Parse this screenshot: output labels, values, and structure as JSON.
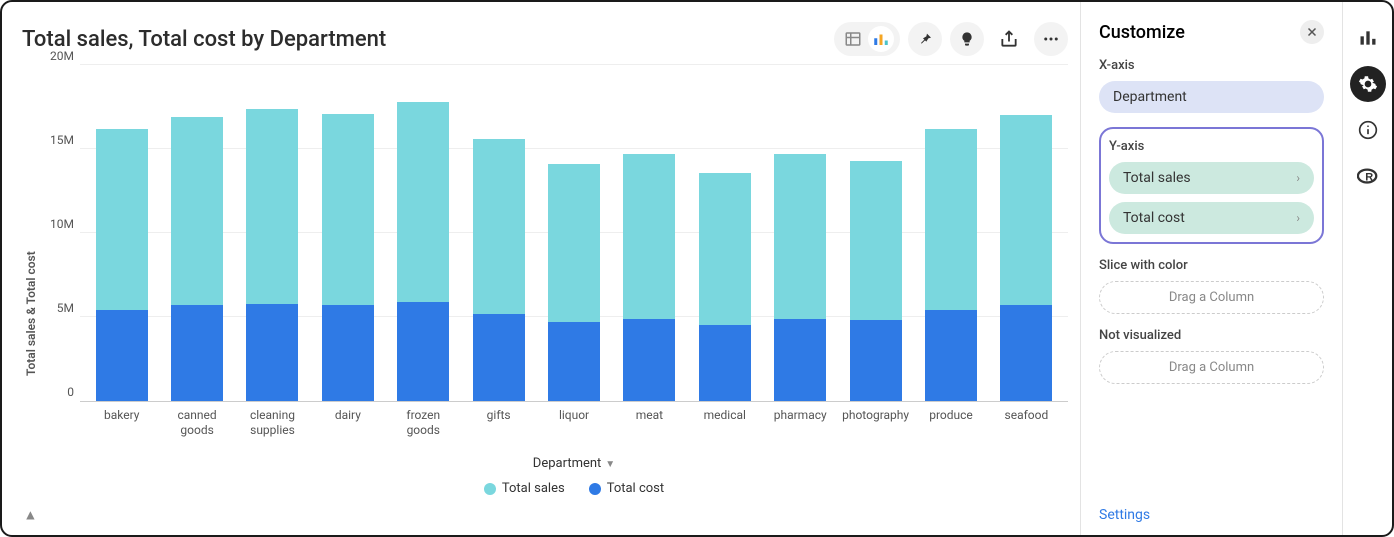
{
  "title": "Total sales, Total cost by Department",
  "customize": {
    "title": "Customize",
    "xaxis_label": "X-axis",
    "xaxis_value": "Department",
    "yaxis_label": "Y-axis",
    "yaxis_items": [
      "Total sales",
      "Total cost"
    ],
    "slice_label": "Slice with color",
    "drag_placeholder": "Drag a Column",
    "not_visualized_label": "Not visualized",
    "settings_link": "Settings"
  },
  "legend": {
    "sales": "Total sales",
    "cost": "Total cost"
  },
  "y_axis_title": "Total sales & Total cost",
  "x_axis_title": "Department",
  "y_ticks": [
    "0",
    "5M",
    "10M",
    "15M",
    "20M"
  ],
  "chart_data": {
    "type": "bar",
    "stacked": true,
    "title": "Total sales, Total cost by Department",
    "xlabel": "Department",
    "ylabel": "Total sales & Total cost",
    "ylim": [
      0,
      20000000
    ],
    "categories": [
      "bakery",
      "canned goods",
      "cleaning supplies",
      "dairy",
      "frozen goods",
      "gifts",
      "liquor",
      "meat",
      "medical",
      "pharmacy",
      "photography",
      "produce",
      "seafood"
    ],
    "series": [
      {
        "name": "Total cost",
        "color": "#2f7ae5",
        "values": [
          5400000,
          5700000,
          5800000,
          5700000,
          5900000,
          5200000,
          4700000,
          4900000,
          4500000,
          4900000,
          4800000,
          5400000,
          5700000
        ]
      },
      {
        "name": "Total sales",
        "color": "#7ad7de",
        "values": [
          10800000,
          11200000,
          11600000,
          11400000,
          11900000,
          10400000,
          9400000,
          9800000,
          9100000,
          9800000,
          9500000,
          10800000,
          11300000
        ]
      }
    ],
    "legend_position": "bottom",
    "grid": true
  }
}
